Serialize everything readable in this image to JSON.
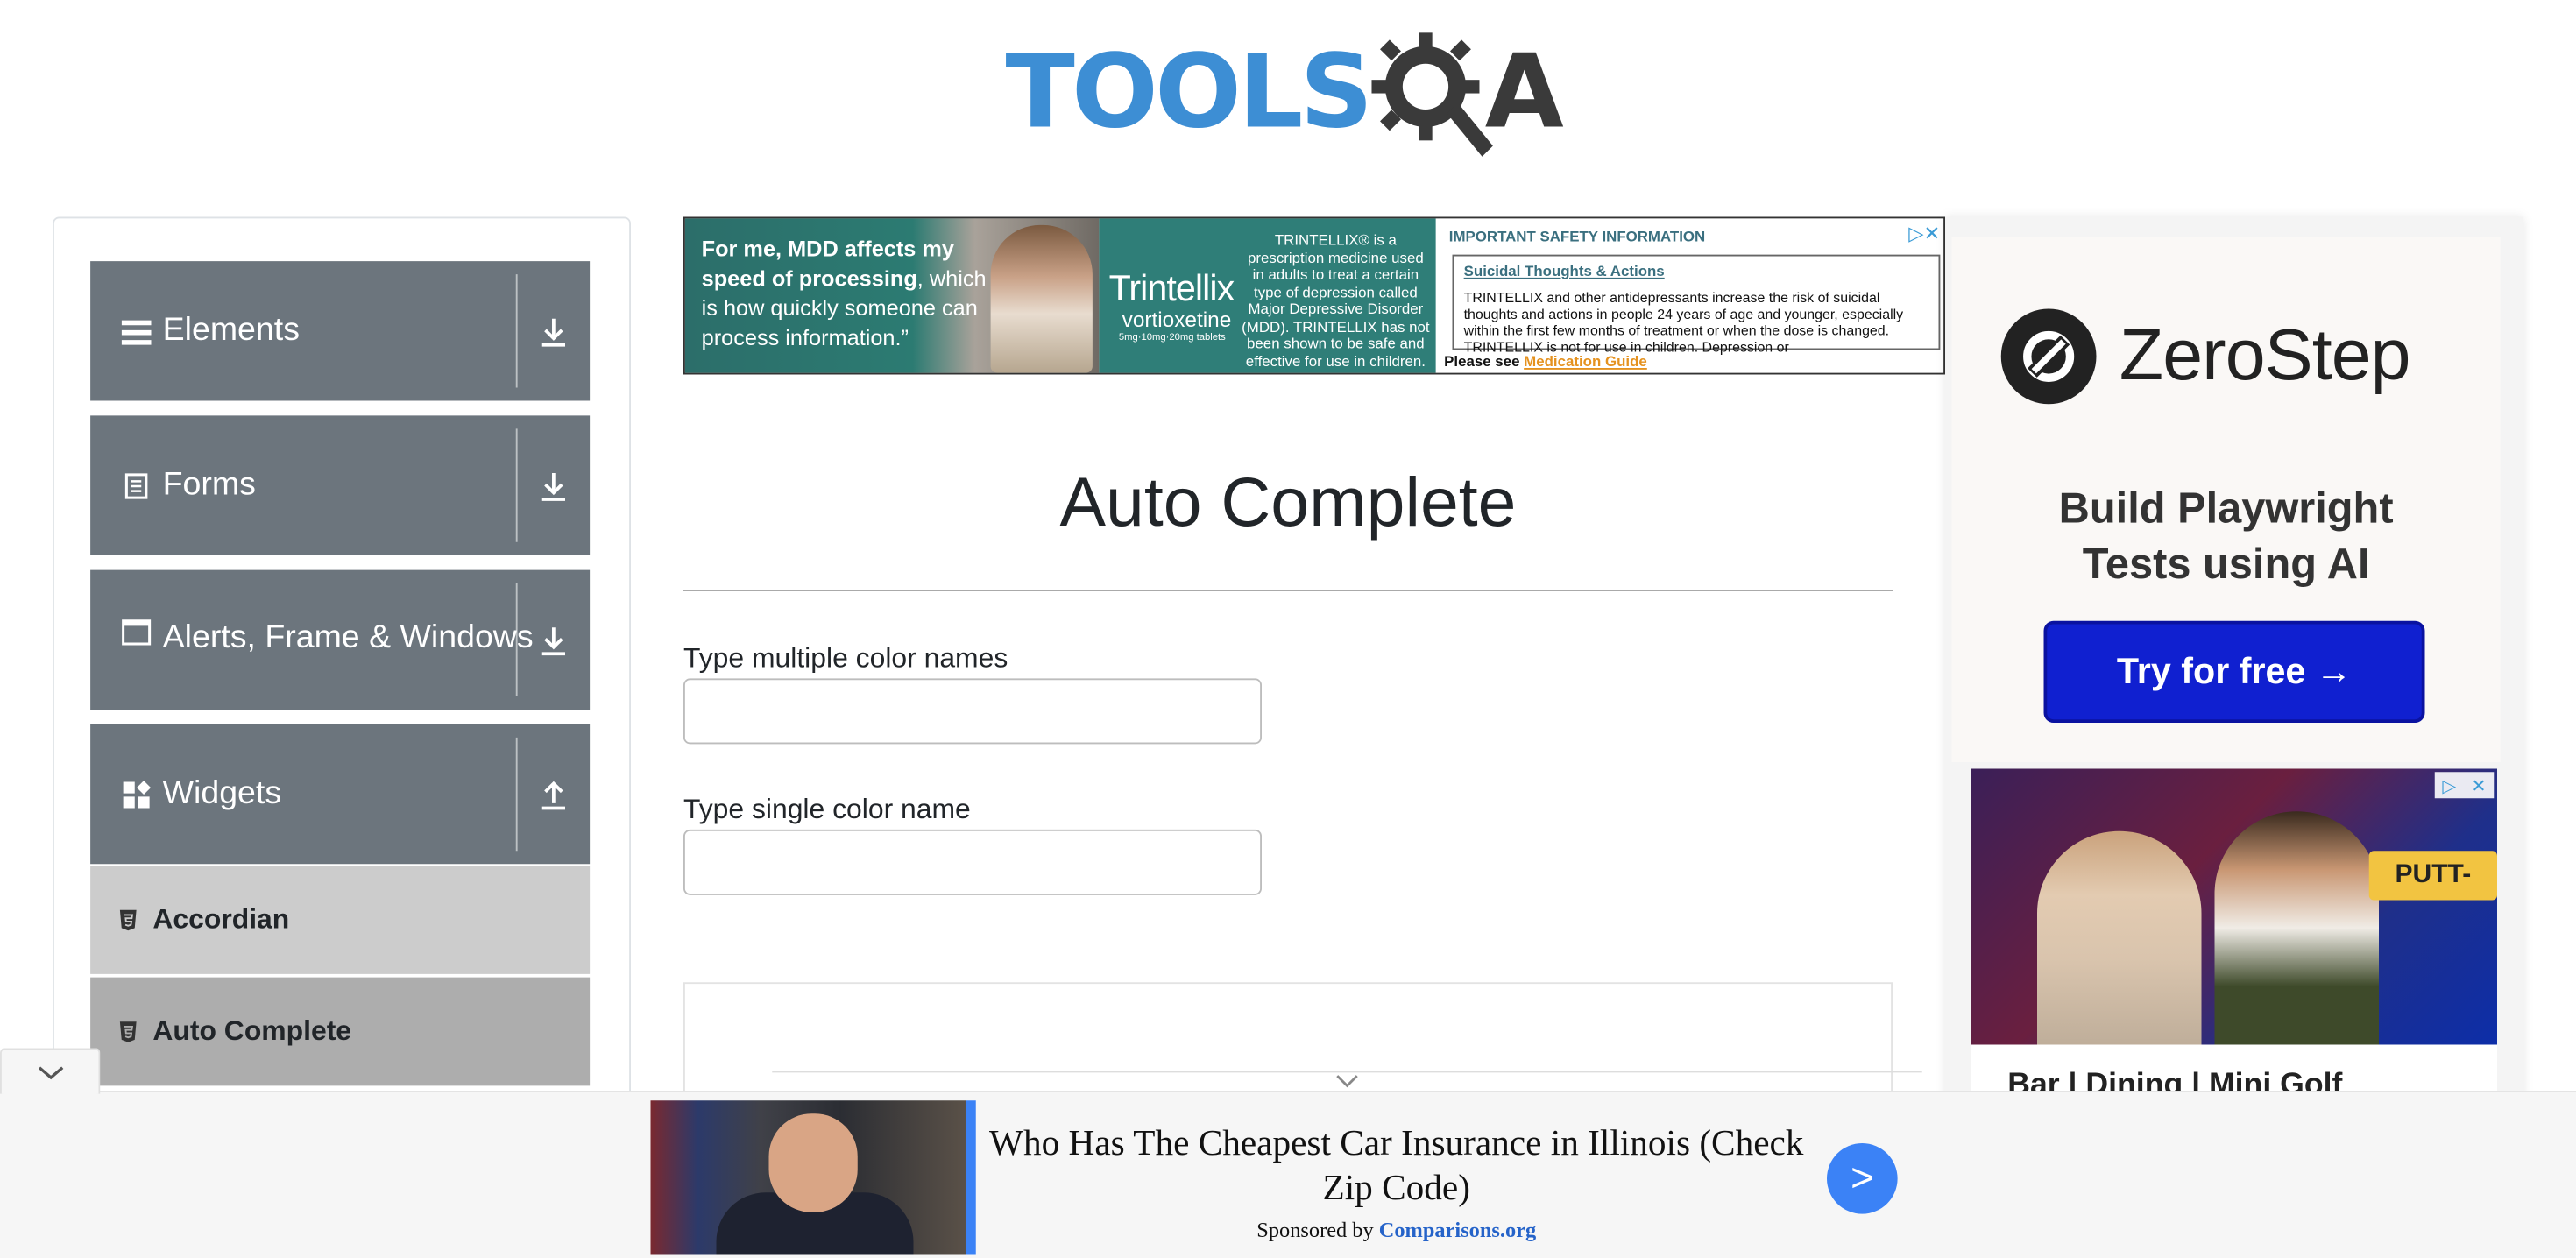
{
  "header": {
    "logo_text": "TOOLS",
    "logo_suffix": "A"
  },
  "sidebar": {
    "groups": [
      {
        "label": "Elements",
        "icon": "hamburger-icon",
        "state": "collapsed"
      },
      {
        "label": "Forms",
        "icon": "document-icon",
        "state": "collapsed"
      },
      {
        "label": "Alerts, Frame & Windows",
        "icon": "window-icon",
        "state": "collapsed"
      },
      {
        "label": "Widgets",
        "icon": "widgets-icon",
        "state": "expanded"
      }
    ],
    "items": [
      {
        "label": "Accordian",
        "icon": "html5-icon",
        "active": false
      },
      {
        "label": "Auto Complete",
        "icon": "html5-icon",
        "active": true
      }
    ]
  },
  "top_ad": {
    "quote_open": "“For me, MDD affects my",
    "quote_bold_1": "speed of processing",
    "quote_rest": ", which is how quickly someone can process information.”",
    "quote_bold_0": "For me, MDD affects my",
    "brand": "Trintellix",
    "brand_sub": "vortioxetine",
    "brand_dose": "5mg·10mg·20mg tablets",
    "description": "TRINTELLIX® is a prescription medicine used in adults to treat a certain type of depression called Major Depressive Disorder (MDD). TRINTELLIX has not been shown to be safe and effective for use in children.",
    "isi_heading": "IMPORTANT SAFETY INFORMATION",
    "box_title": "Suicidal Thoughts & Actions",
    "box_text": "TRINTELLIX and other antidepressants increase the risk of suicidal thoughts and actions in people 24 years of age and younger, especially within the first few months of treatment or when the dose is changed. TRINTELLIX is not for use in children. Depression or",
    "see_prefix": "Please see ",
    "see_link": "Medication Guide"
  },
  "main": {
    "title": "Auto Complete",
    "fields": [
      {
        "label": "Type multiple color names",
        "value": "",
        "placeholder": ""
      },
      {
        "label": "Type single color name",
        "value": "",
        "placeholder": ""
      }
    ]
  },
  "right_ad": {
    "brand": "ZeroStep",
    "tagline_1": "Build Playwright",
    "tagline_2": "Tests using AI",
    "cta": "Try for free →",
    "bar_sign": "PUTT-",
    "bar_caption": "Bar | Dining | Mini Golf"
  },
  "bottom_ad": {
    "headline": "Who Has The Cheapest Car Insurance in Illinois (Check Zip Code)",
    "sponsor_prefix": "Sponsored by ",
    "sponsor_name": "Comparisons.org",
    "go_label": ">"
  },
  "colors": {
    "sidebar_group": "#6c757d",
    "sidebar_item_active": "#adadad",
    "sidebar_item": "#cccccc",
    "logo_blue": "#3d8ed4",
    "cta_blue": "#1020d0",
    "ad_accent": "#3b82f6"
  }
}
